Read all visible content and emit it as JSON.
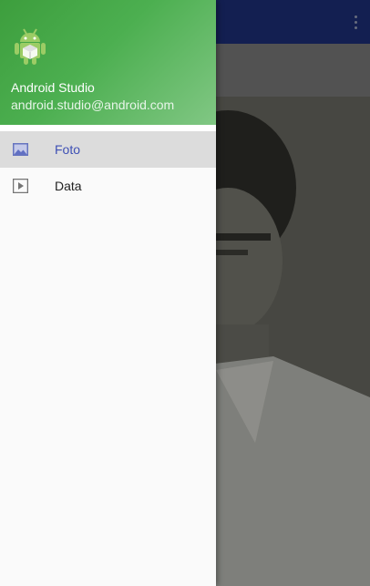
{
  "drawer": {
    "header": {
      "name": "Android Studio",
      "email": "android.studio@android.com",
      "logo_icon": "android-robot-icon"
    },
    "items": [
      {
        "label": "Foto",
        "icon": "image-icon",
        "selected": true
      },
      {
        "label": "Data",
        "icon": "play-icon",
        "selected": false
      }
    ]
  },
  "toolbar": {
    "overflow_icon": "more-vert-icon"
  },
  "colors": {
    "toolbar": "#1a2a6c",
    "drawer_header": "#4caf50",
    "selected_text": "#3f51b5",
    "selected_bg": "#dcdcdc"
  }
}
